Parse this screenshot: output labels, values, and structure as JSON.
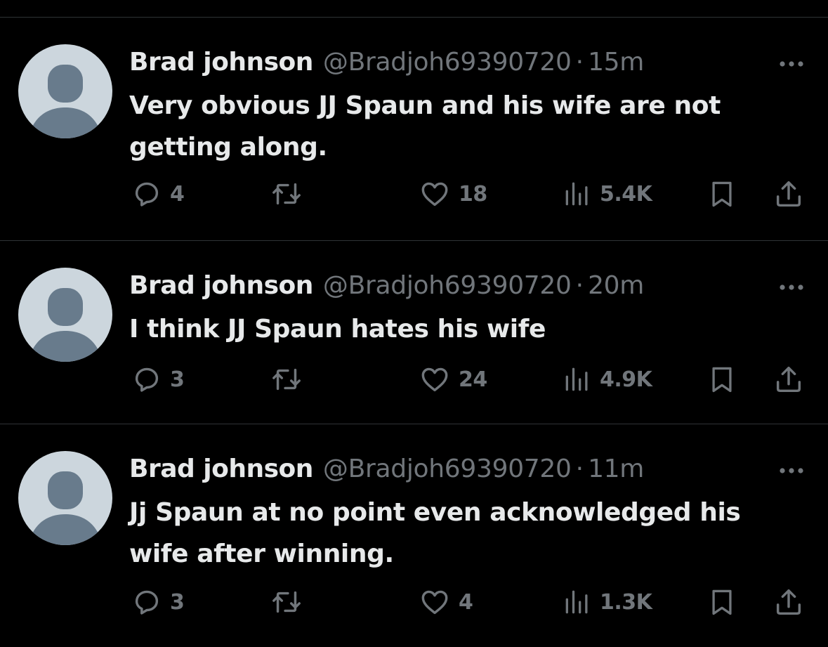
{
  "colors": {
    "background": "#000000",
    "primary_text": "#e7e9ea",
    "secondary_text": "#71767b",
    "divider": "#2f3336",
    "avatar_bg": "#ccd6dd",
    "avatar_fg": "#687b8c"
  },
  "icons": {
    "reply": "reply-icon",
    "retweet": "retweet-icon",
    "like": "heart-icon",
    "views": "views-icon",
    "bookmark": "bookmark-icon",
    "share": "share-icon",
    "more": "more-icon"
  },
  "tweets": [
    {
      "name": "Brad johnson",
      "handle": "@Bradjoh69390720",
      "separator": "·",
      "time": "15m",
      "text": "Very obvious JJ Spaun and his wife are not getting along.",
      "replies": "4",
      "retweets": "",
      "likes": "18",
      "views": "5.4K"
    },
    {
      "name": "Brad johnson",
      "handle": "@Bradjoh69390720",
      "separator": "·",
      "time": "20m",
      "text": "I think JJ Spaun hates his wife",
      "replies": "3",
      "retweets": "",
      "likes": "24",
      "views": "4.9K"
    },
    {
      "name": "Brad johnson",
      "handle": "@Bradjoh69390720",
      "separator": "·",
      "time": "11m",
      "text": "Jj Spaun at no point even acknowledged his wife after winning.",
      "replies": "3",
      "retweets": "",
      "likes": "4",
      "views": "1.3K"
    }
  ]
}
